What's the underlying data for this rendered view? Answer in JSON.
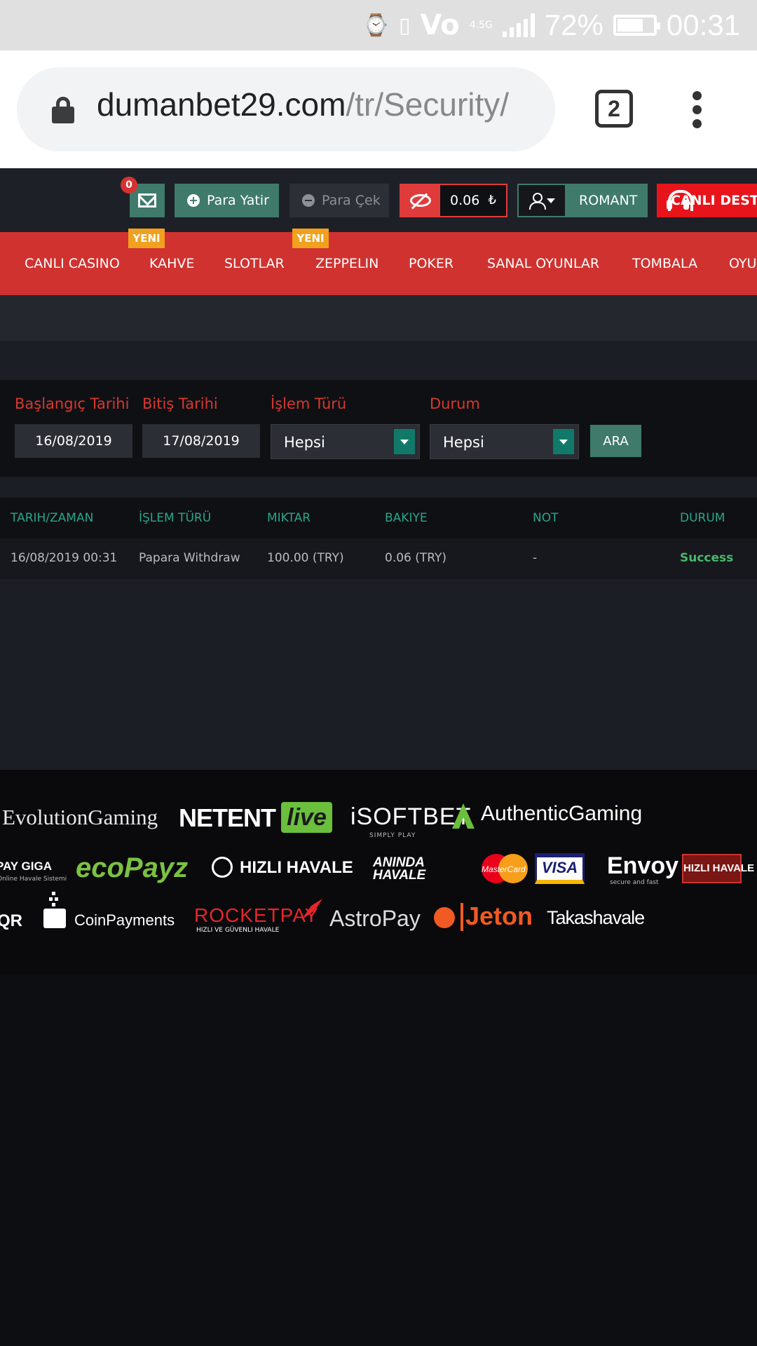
{
  "status_bar": {
    "lte_label": "4.5G",
    "battery": "72%",
    "battery_level": 0.72,
    "time": "00:31"
  },
  "browser": {
    "url_host": "dumanbet29.com",
    "url_path": "/tr/Security/",
    "tab_count": "2"
  },
  "header": {
    "mail_count": "0",
    "deposit_label": "Para Yatir",
    "withdraw_label": "Para Çek",
    "balance": "0.06",
    "currency": "₺",
    "username": "ROMANT",
    "live_support_label": "CANLI DESTEK"
  },
  "nav": {
    "items": [
      {
        "label": "CANLI CASINO"
      },
      {
        "label": "KAHVE",
        "badge": "YENI"
      },
      {
        "label": "SLOTLAR"
      },
      {
        "label": "ZEPPELIN",
        "badge": "YENI"
      },
      {
        "label": "POKER"
      },
      {
        "label": "SANAL OYUNLAR"
      },
      {
        "label": "TOMBALA"
      },
      {
        "label": "OYUNLAR"
      }
    ]
  },
  "filter": {
    "start_label": "Başlangıç Tarihi",
    "start_value": "16/08/2019",
    "end_label": "Bitiş Tarihi",
    "end_value": "17/08/2019",
    "type_label": "İşlem Türü",
    "type_value": "Hepsi",
    "status_label": "Durum",
    "status_value": "Hepsi",
    "search_label": "ARA"
  },
  "table": {
    "headers": [
      "TARIH/ZAMAN",
      "İŞLEM TÜRÜ",
      "MIKTAR",
      "BAKIYE",
      "NOT",
      "DURUM"
    ],
    "rows": [
      [
        "16/08/2019 00:31",
        "Papara Withdraw",
        "100.00 (TRY)",
        "0.06 (TRY)",
        "-",
        "Success"
      ]
    ]
  },
  "providers": {
    "row1": [
      "EvolutionGaming",
      "NETENT",
      "live",
      "iSOFTBET",
      "SIMPLY PLAY",
      "AuthenticGaming"
    ],
    "row2": [
      "PAY GIGA",
      "Online Havale Sistemi",
      "ecoPayz",
      "HIZLI HAVALE",
      "ANINDA HAVALE",
      "MasterCard",
      "VISA",
      "Envoy",
      "secure and fast",
      "HIZLI HAVALE"
    ],
    "row3": [
      "QR",
      "CoinPayments",
      "ROCKETPAY",
      "HIZLI VE GÜVENLI HAVALE",
      "AstroPay",
      "Jeton",
      "Takashavale"
    ]
  },
  "colors": {
    "accent_red": "#d03230",
    "accent_green": "#3f7a6a",
    "success": "#49b86b",
    "header_teal": "#2aa58a"
  }
}
